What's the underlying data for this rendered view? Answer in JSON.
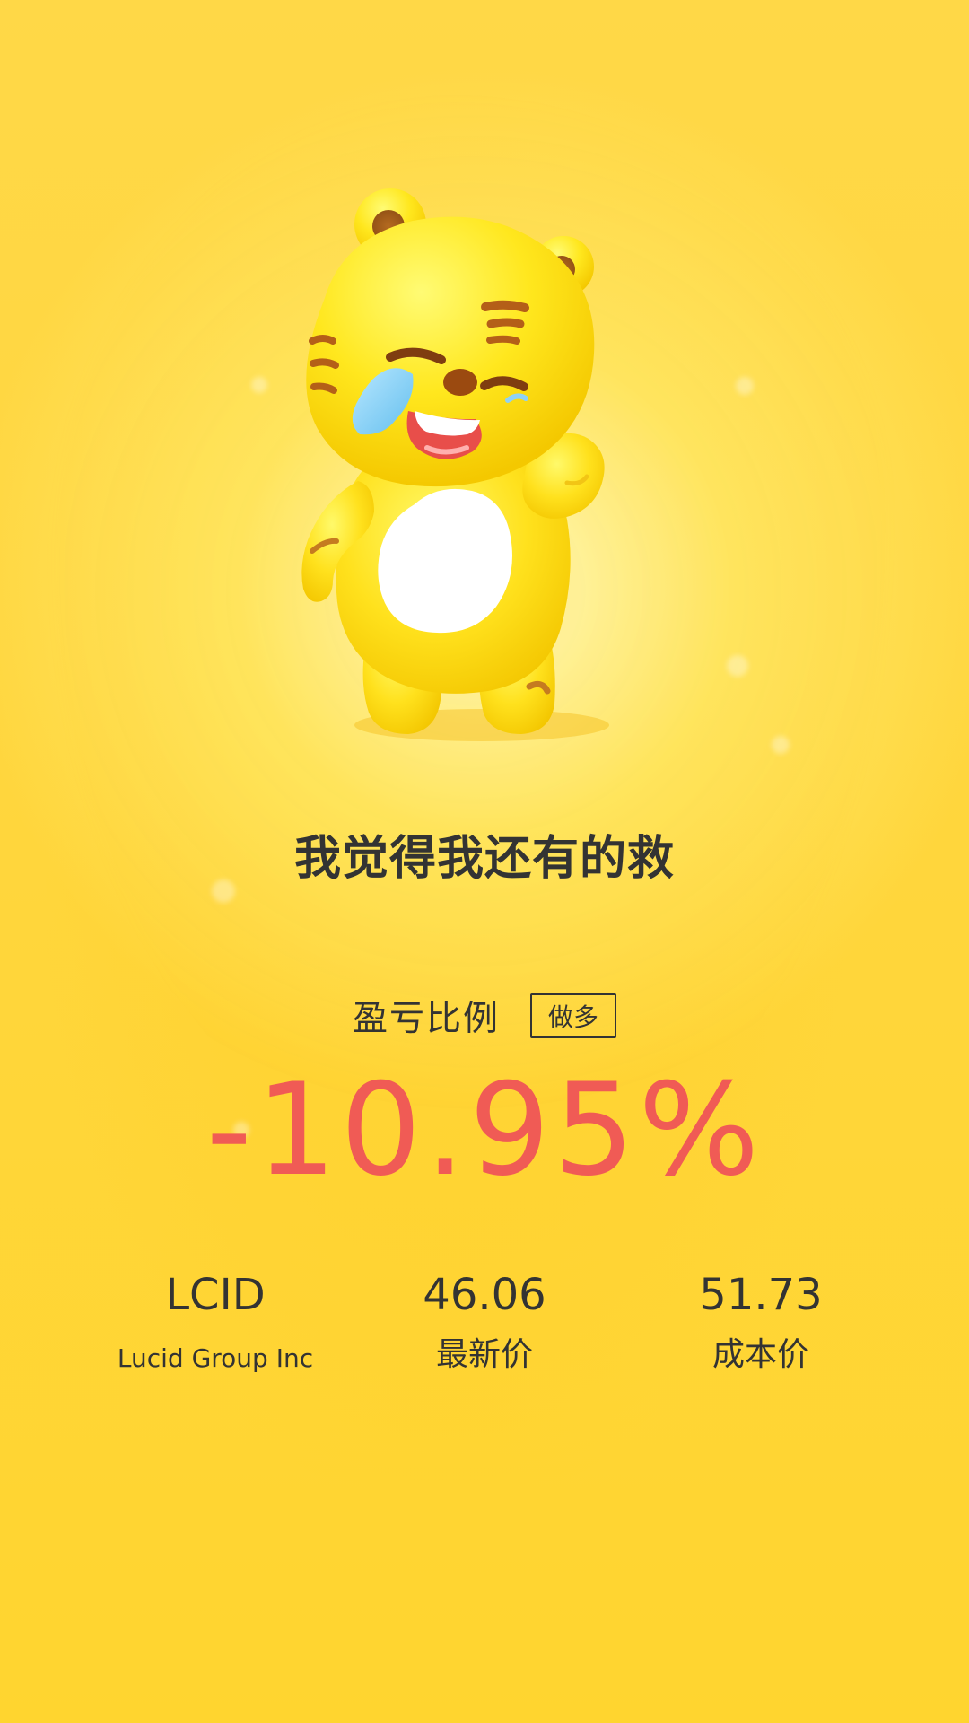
{
  "headline": "我觉得我还有的救",
  "profit_loss": {
    "label": "盈亏比例",
    "position": "做多",
    "percent": "-10.95%"
  },
  "stock": {
    "ticker": "LCID",
    "name": "Lucid Group Inc",
    "latest_price": "46.06",
    "latest_price_label": "最新价",
    "cost_price": "51.73",
    "cost_price_label": "成本价"
  },
  "icons": {
    "mascot": "crying-tiger-mascot-illustration"
  },
  "colors": {
    "background": "#ffd83a",
    "text": "#333333",
    "loss": "#f05b55"
  }
}
